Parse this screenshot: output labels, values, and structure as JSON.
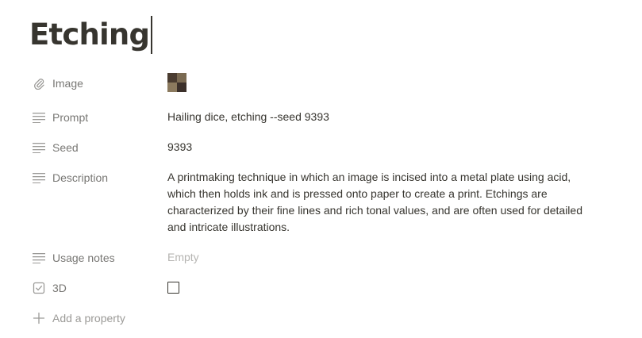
{
  "page": {
    "title": "Etching"
  },
  "properties": [
    {
      "name": "Image",
      "icon": "paperclip-icon",
      "value": ""
    },
    {
      "name": "Prompt",
      "icon": "text-lines-icon",
      "value": "Hailing dice, etching --seed 9393"
    },
    {
      "name": "Seed",
      "icon": "text-lines-icon",
      "value": "9393"
    },
    {
      "name": "Description",
      "icon": "text-lines-icon",
      "value": "A printmaking technique in which an image is incised into a metal plate using acid, which then holds ink and is pressed onto paper to create a print. Etchings are characterized by their fine lines and rich tonal values, and are often used for detailed and intricate illustrations."
    },
    {
      "name": "Usage notes",
      "icon": "text-lines-icon",
      "value": "Empty"
    },
    {
      "name": "3D",
      "icon": "checkbox-property-icon",
      "checked": false
    }
  ],
  "add_property": {
    "label": "Add a property",
    "icon": "plus-icon"
  }
}
